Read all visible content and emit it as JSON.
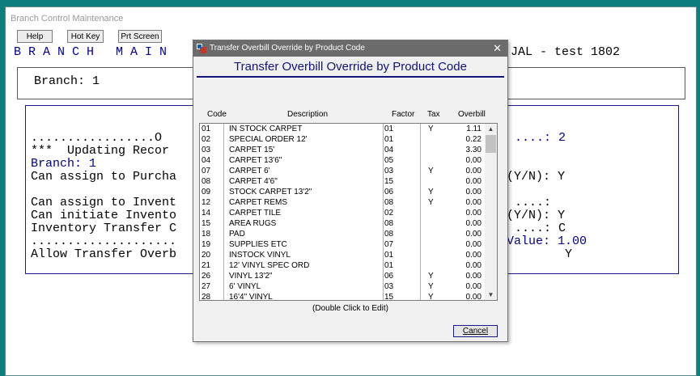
{
  "window": {
    "title": "Branch Control Maintenance"
  },
  "toolbar": {
    "help": "Help",
    "hotkey": "Hot Key",
    "prtscreen": "Prt Screen"
  },
  "header": {
    "left": "B R A N C H   M A I N",
    "right": "JAL - test 1802"
  },
  "branch": {
    "label": "Branch: 1"
  },
  "terminal": {
    "line1_left": ".................O",
    "line1_right": "....: 2",
    "line2": "***  Updating Recor",
    "line3": "Branch: 1",
    "line4_left": "Can assign to Purcha",
    "line4_right": "(Y/N): Y",
    "line5_left": "Can assign to Invent",
    "line5_right": "....:",
    "line6_left": "Can initiate Invento",
    "line6_right": "(Y/N): Y",
    "line7_left": "Inventory Transfer C",
    "line7_right": "....: C",
    "line8_left": "....................",
    "line8_right": "Value: 1.00",
    "line9_left": "Allow Transfer Overb",
    "line9_right": "Y"
  },
  "dialog": {
    "title": "Transfer Overbill Override by Product Code",
    "heading": "Transfer Overbill Override by Product Code",
    "columns": {
      "code": "Code",
      "description": "Description",
      "factor": "Factor",
      "tax": "Tax",
      "overbill": "Overbill"
    },
    "rows": [
      {
        "code": "01",
        "description": "IN STOCK CARPET",
        "factor": "01",
        "tax": "Y",
        "overbill": "1.11"
      },
      {
        "code": "02",
        "description": "SPECIAL ORDER 12'",
        "factor": "01",
        "tax": "",
        "overbill": "0.22"
      },
      {
        "code": "03",
        "description": "CARPET 15'",
        "factor": "04",
        "tax": "",
        "overbill": "3.30"
      },
      {
        "code": "04",
        "description": "CARPET 13'6\"",
        "factor": "05",
        "tax": "",
        "overbill": "0.00"
      },
      {
        "code": "07",
        "description": "CARPET 6'",
        "factor": "03",
        "tax": "Y",
        "overbill": "0.00"
      },
      {
        "code": "08",
        "description": "CARPET 4'6\"",
        "factor": "15",
        "tax": "",
        "overbill": "0.00"
      },
      {
        "code": "09",
        "description": "STOCK CARPET 13'2\"",
        "factor": "06",
        "tax": "Y",
        "overbill": "0.00"
      },
      {
        "code": "12",
        "description": "CARPET REMS",
        "factor": "08",
        "tax": "Y",
        "overbill": "0.00"
      },
      {
        "code": "14",
        "description": "CARPET TILE",
        "factor": "02",
        "tax": "",
        "overbill": "0.00"
      },
      {
        "code": "15",
        "description": "AREA RUGS",
        "factor": "08",
        "tax": "",
        "overbill": "0.00"
      },
      {
        "code": "18",
        "description": "PAD",
        "factor": "08",
        "tax": "",
        "overbill": "0.00"
      },
      {
        "code": "19",
        "description": "SUPPLIES ETC",
        "factor": "07",
        "tax": "",
        "overbill": "0.00"
      },
      {
        "code": "20",
        "description": "INSTOCK VINYL",
        "factor": "01",
        "tax": "",
        "overbill": "0.00"
      },
      {
        "code": "21",
        "description": "12' VINYL SPEC ORD",
        "factor": "01",
        "tax": "",
        "overbill": "0.00"
      },
      {
        "code": "26",
        "description": "VINYL 13'2\"",
        "factor": "06",
        "tax": "Y",
        "overbill": "0.00"
      },
      {
        "code": "27",
        "description": "6' VINYL",
        "factor": "03",
        "tax": "Y",
        "overbill": "0.00"
      },
      {
        "code": "28",
        "description": "16'4\" VINYL",
        "factor": "15",
        "tax": "Y",
        "overbill": "0.00"
      }
    ],
    "hint": "(Double Click to Edit)",
    "cancel": "Cancel"
  }
}
